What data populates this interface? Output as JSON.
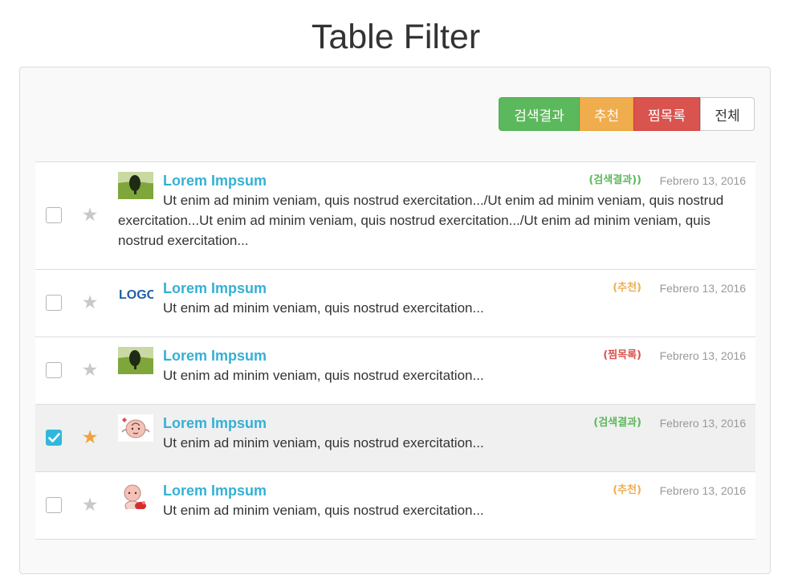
{
  "page": {
    "title": "Table Filter"
  },
  "filters": {
    "search_results": "검색결과",
    "recommended": "추천",
    "wishlist": "찜목록",
    "all": "전체"
  },
  "rows": [
    {
      "name": "Lorem Impsum",
      "tag": "(검색결과))",
      "tag_color": "#5cb85c",
      "date": "Febrero 13, 2016",
      "text": "Ut enim ad minim veniam, quis nostrud exercitation.../Ut enim ad minim veniam, quis nostrud exercitation...Ut enim ad minim veniam, quis nostrud exercitation.../Ut enim ad minim veniam, quis nostrud exercitation...",
      "checked": false,
      "starred": false,
      "thumb": "tree-thumbnail"
    },
    {
      "name": "Lorem Impsum",
      "tag": "(추천)",
      "tag_color": "#f0ad4e",
      "date": "Febrero 13, 2016",
      "text": "Ut enim ad minim veniam, quis nostrud exercitation...",
      "checked": false,
      "starred": false,
      "thumb": "logo-thumbnail",
      "logo_text": "LOGO"
    },
    {
      "name": "Lorem Impsum",
      "tag": "(찜목록)",
      "tag_color": "#d9534f",
      "date": "Febrero 13, 2016",
      "text": "Ut enim ad minim veniam, quis nostrud exercitation...",
      "checked": false,
      "starred": false,
      "thumb": "tree-thumbnail"
    },
    {
      "name": "Lorem Impsum",
      "tag": "(검색결과)",
      "tag_color": "#5cb85c",
      "date": "Febrero 13, 2016",
      "text": "Ut enim ad minim veniam, quis nostrud exercitation...",
      "checked": true,
      "starred": true,
      "thumb": "peach-character-thumbnail"
    },
    {
      "name": "Lorem Impsum",
      "tag": "(추천)",
      "tag_color": "#f0ad4e",
      "date": "Febrero 13, 2016",
      "text": "Ut enim ad minim veniam, quis nostrud exercitation...",
      "checked": false,
      "starred": false,
      "thumb": "peach-character-thumbnail"
    }
  ],
  "colors": {
    "accent": "#35b0d4",
    "checkbox_checked": "#2fb7de",
    "star_active": "#f0a33a",
    "star_inactive": "#c8c8c8",
    "selected_row": "#f0f0f0"
  }
}
